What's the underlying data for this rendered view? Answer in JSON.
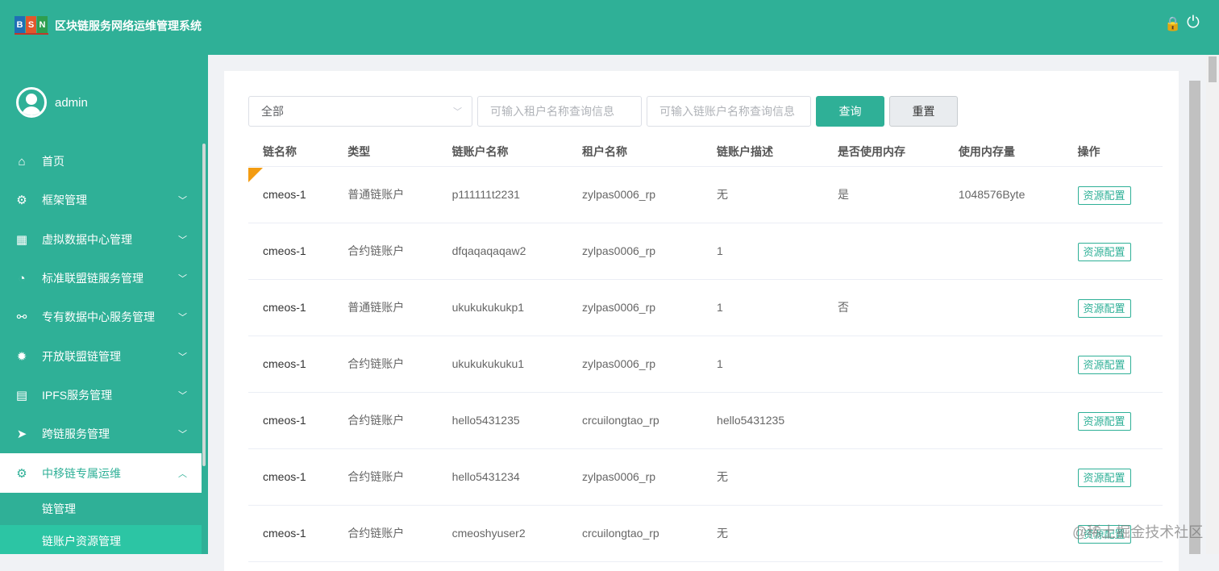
{
  "header": {
    "logo": [
      "B",
      "S",
      "N"
    ],
    "logo_colors": [
      "#1f6fb5",
      "#e2572b",
      "#2e9e4f"
    ],
    "title": "区块链服务网络运维管理系统",
    "icons": [
      "lock-icon",
      "power-icon"
    ]
  },
  "user": {
    "name": "admin"
  },
  "menu": [
    {
      "label": "首页",
      "icon": "⌂",
      "chevron": false
    },
    {
      "label": "框架管理",
      "icon": "⚙",
      "chevron": true
    },
    {
      "label": "虚拟数据中心管理",
      "icon": "▦",
      "chevron": true
    },
    {
      "label": "标准联盟链服务管理",
      "icon": "◔",
      "chevron": true
    },
    {
      "label": "专有数据中心服务管理",
      "icon": "⚯",
      "chevron": true
    },
    {
      "label": "开放联盟链管理",
      "icon": "✹",
      "chevron": true
    },
    {
      "label": "IPFS服务管理",
      "icon": "▤",
      "chevron": true
    },
    {
      "label": "跨链服务管理",
      "icon": "➤",
      "chevron": true
    },
    {
      "label": "中移链专属运维",
      "icon": "⚙",
      "chevron": true
    }
  ],
  "submenu": [
    "链管理",
    "链账户资源管理"
  ],
  "filters": {
    "type_value": "全部",
    "tenant_placeholder": "可输入租户名称查询信息",
    "account_placeholder": "可输入链账户名称查询信息",
    "query": "查询",
    "reset": "重置"
  },
  "table": {
    "columns": [
      "链名称",
      "类型",
      "链账户名称",
      "租户名称",
      "链账户描述",
      "是否使用内存",
      "使用内存量",
      "操作"
    ],
    "rows": [
      [
        "cmeos-1",
        "普通链账户",
        "p111111t2231",
        "zylpas0006_rp",
        "无",
        "是",
        "1048576Byte",
        "资源配置"
      ],
      [
        "cmeos-1",
        "合约链账户",
        "dfqaqaqaqaw2",
        "zylpas0006_rp",
        "1",
        "",
        "",
        "资源配置"
      ],
      [
        "cmeos-1",
        "普通链账户",
        "ukukukukukp1",
        "zylpas0006_rp",
        "1",
        "否",
        "",
        "资源配置"
      ],
      [
        "cmeos-1",
        "合约链账户",
        "ukukukukuku1",
        "zylpas0006_rp",
        "1",
        "",
        "",
        "资源配置"
      ],
      [
        "cmeos-1",
        "合约链账户",
        "hello5431235",
        "crcuilongtao_rp",
        "hello5431235",
        "",
        "",
        "资源配置"
      ],
      [
        "cmeos-1",
        "合约链账户",
        "hello5431234",
        "zylpas0006_rp",
        "无",
        "",
        "",
        "资源配置"
      ],
      [
        "cmeos-1",
        "合约链账户",
        "cmeoshyuser2",
        "crcuilongtao_rp",
        "无",
        "",
        "",
        "资源配置"
      ]
    ]
  },
  "watermark": "@稀土掘金技术社区"
}
